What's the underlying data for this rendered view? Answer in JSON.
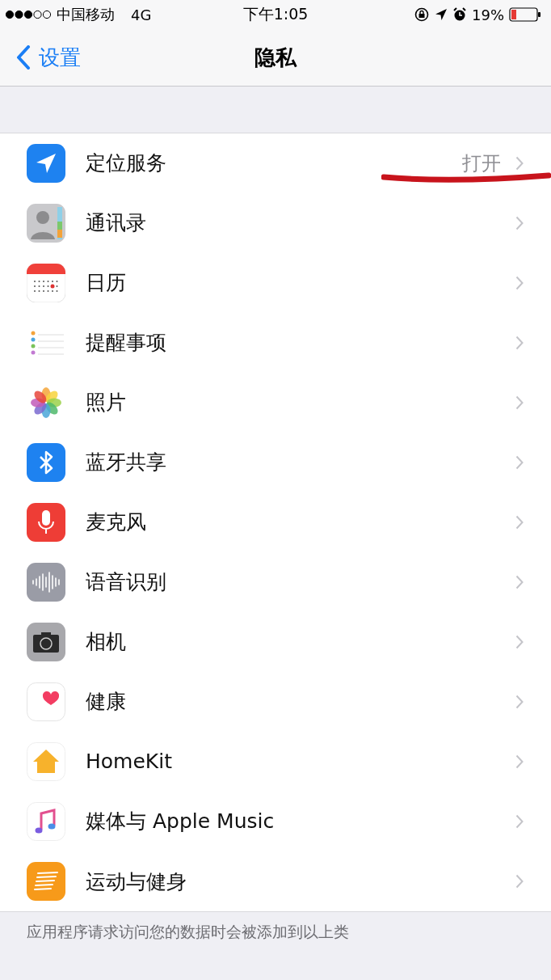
{
  "status_bar": {
    "carrier": "中国移动",
    "network": "4G",
    "time": "下午1:05",
    "battery": "19%"
  },
  "nav": {
    "back": "设置",
    "title": "隐私"
  },
  "items": [
    {
      "kind": "location",
      "label": "定位服务",
      "value": "打开"
    },
    {
      "kind": "contacts",
      "label": "通讯录"
    },
    {
      "kind": "calendar",
      "label": "日历"
    },
    {
      "kind": "reminders",
      "label": "提醒事项"
    },
    {
      "kind": "photos",
      "label": "照片"
    },
    {
      "kind": "bluetooth",
      "label": "蓝牙共享"
    },
    {
      "kind": "microphone",
      "label": "麦克风"
    },
    {
      "kind": "speech",
      "label": "语音识别"
    },
    {
      "kind": "camera",
      "label": "相机"
    },
    {
      "kind": "health",
      "label": "健康"
    },
    {
      "kind": "homekit",
      "label": "HomeKit"
    },
    {
      "kind": "music",
      "label": "媒体与 Apple Music"
    },
    {
      "kind": "motion",
      "label": "运动与健身"
    }
  ],
  "footer": "应用程序请求访问您的数据时会被添加到以上类"
}
